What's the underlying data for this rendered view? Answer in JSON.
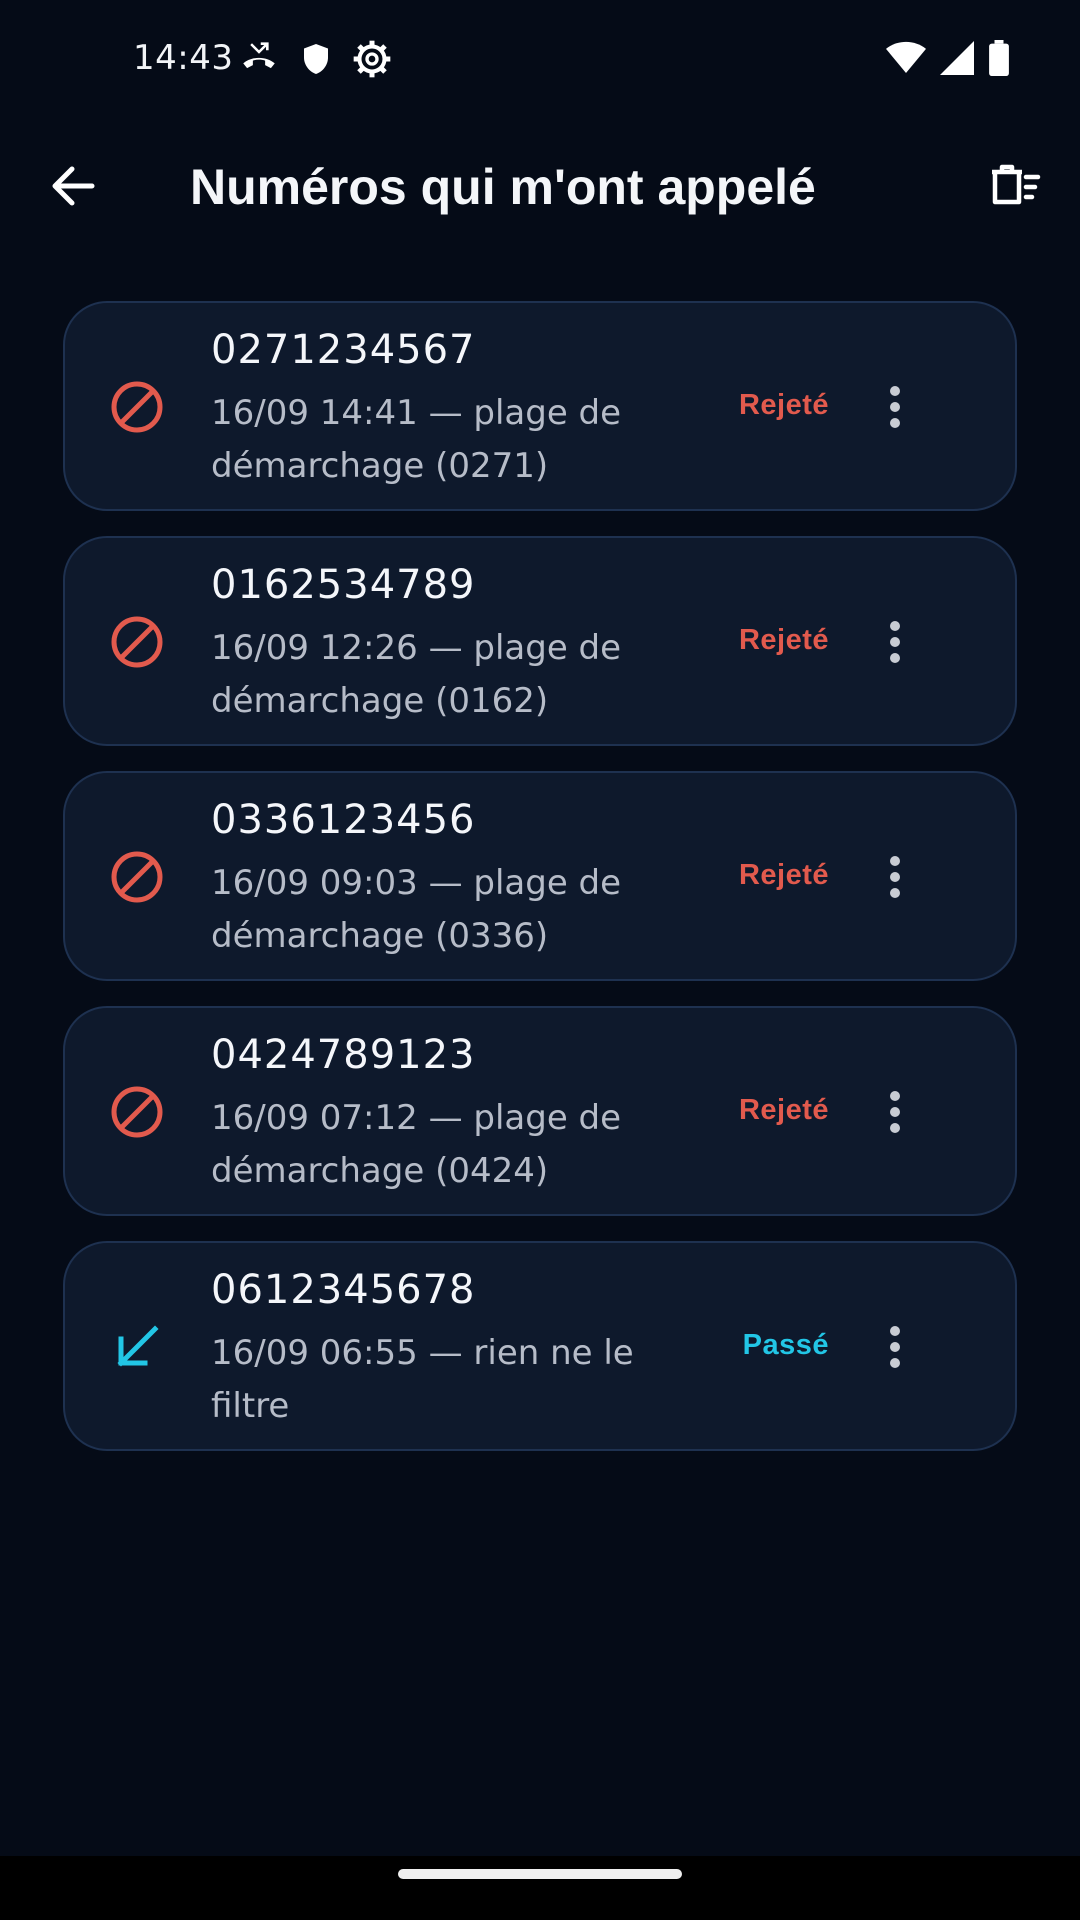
{
  "status_bar": {
    "time": "14:43",
    "left_icons": [
      "missed-call-icon",
      "shield-icon",
      "settings-gear-icon"
    ],
    "right_icons": [
      "wifi-icon",
      "cellular-signal-icon",
      "battery-icon"
    ]
  },
  "app_bar": {
    "title": "Numéros qui m'ont appelé",
    "back_icon": "arrow-left-icon",
    "action_icon": "delete-sweep-icon"
  },
  "calls": [
    {
      "number": "0271234567",
      "detail": "16/09 14:41 — plage de démarchage (0271)",
      "status": "Rejeté",
      "kind": "rejected",
      "icon": "block-icon"
    },
    {
      "number": "0162534789",
      "detail": "16/09 12:26 — plage de démarchage (0162)",
      "status": "Rejeté",
      "kind": "rejected",
      "icon": "block-icon"
    },
    {
      "number": "0336123456",
      "detail": "16/09 09:03 — plage de démarchage (0336)",
      "status": "Rejeté",
      "kind": "rejected",
      "icon": "block-icon"
    },
    {
      "number": "0424789123",
      "detail": "16/09 07:12 — plage de démarchage (0424)",
      "status": "Rejeté",
      "kind": "rejected",
      "icon": "block-icon"
    },
    {
      "number": "0612345678",
      "detail": "16/09 06:55 — rien ne le filtre",
      "status": "Passé",
      "kind": "passed",
      "icon": "incoming-call-arrow-icon"
    }
  ],
  "colors": {
    "background": "#050b17",
    "card": "#0e192c",
    "rejected": "#e25a4d",
    "passed": "#22c6e6"
  }
}
